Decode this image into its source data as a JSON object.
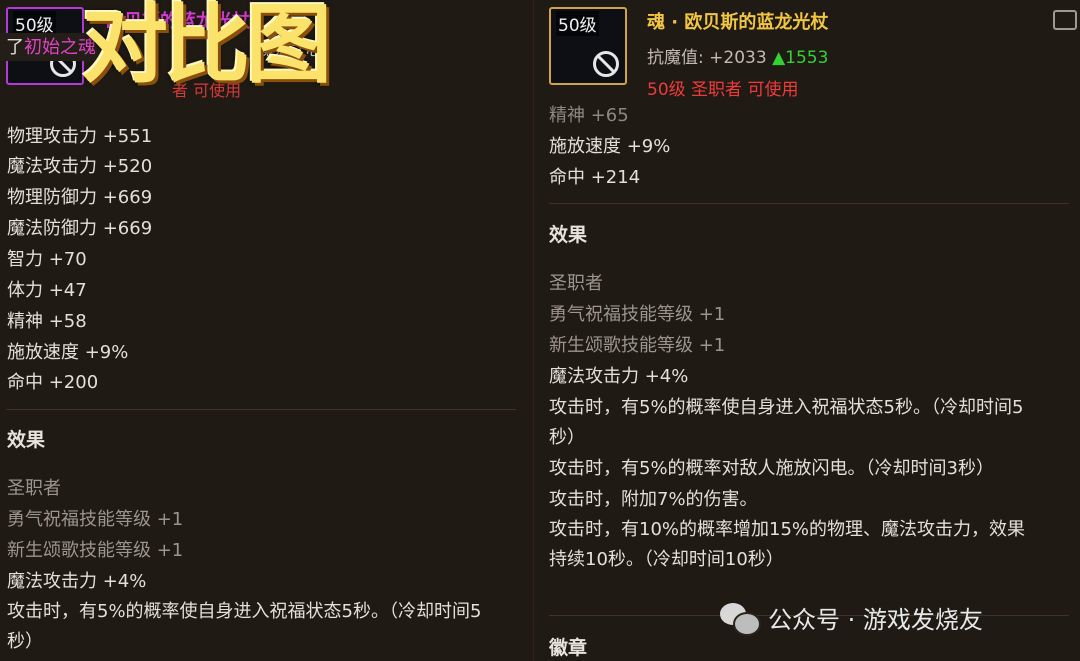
{
  "left_panel": {
    "item_icon": {
      "level_tag": "50级",
      "icon": "weapon-icon",
      "banned_icon": "no-entry-icon"
    },
    "title": "欧贝斯的蓝龙光杖",
    "overlay_text_prefix": "了",
    "overlay_text_highlight": "初始之魂",
    "partial_text": "魔龙之心",
    "requirement_partial": "者 可使用",
    "banner": "对比图",
    "stats": [
      "物理攻击力 +551",
      "魔法攻击力 +520",
      "物理防御力 +669",
      "魔法防御力 +669",
      "智力 +70",
      "体力 +47",
      "精神 +58",
      "施放速度 +9%",
      "命中 +200"
    ],
    "effects_heading": "效果",
    "class_name": "圣职者",
    "effects": [
      "勇气祝福技能等级 +1",
      "新生颂歌技能等级 +1",
      "魔法攻击力 +4%",
      "攻击时，有5%的概率使自身进入祝福状态5秒。（冷却时间5",
      "秒）"
    ]
  },
  "right_panel": {
    "item_icon": {
      "level_tag": "50级",
      "icon": "weapon-icon",
      "banned_icon": "no-entry-icon"
    },
    "title": "魂 · 欧贝斯的蓝龙光杖",
    "resist_label": "抗魔值:",
    "resist_value": "+2033",
    "resist_diff": "▲1553",
    "requirement": "50级 圣职者 可使用",
    "top_partial": "精神 +65",
    "stats": [
      "施放速度 +9%",
      "命中 +214"
    ],
    "effects_heading": "效果",
    "class_name": "圣职者",
    "effects": [
      "勇气祝福技能等级 +1",
      "新生颂歌技能等级 +1",
      "魔法攻击力 +4%",
      "攻击时，有5%的概率使自身进入祝福状态5秒。（冷却时间5",
      "秒）",
      "攻击时，有5%的概率对敌人施放闪电。（冷却时间3秒）",
      "攻击时，附加7%的伤害。",
      "攻击时，有10%的概率增加15%的物理、魔法攻击力，效果",
      "持续10秒。（冷却时间10秒）"
    ],
    "emblem_heading": "徽章",
    "share_icon": "share-icon"
  },
  "watermark": {
    "icon": "wechat-icon",
    "text": "公众号 · 游戏发烧友"
  },
  "colors": {
    "background": "#1f1a14",
    "epic_purple": "#d63bd6",
    "legendary_gold": "#f2c542",
    "increase_green": "#32d233",
    "requirement_red": "#f03a3a"
  }
}
